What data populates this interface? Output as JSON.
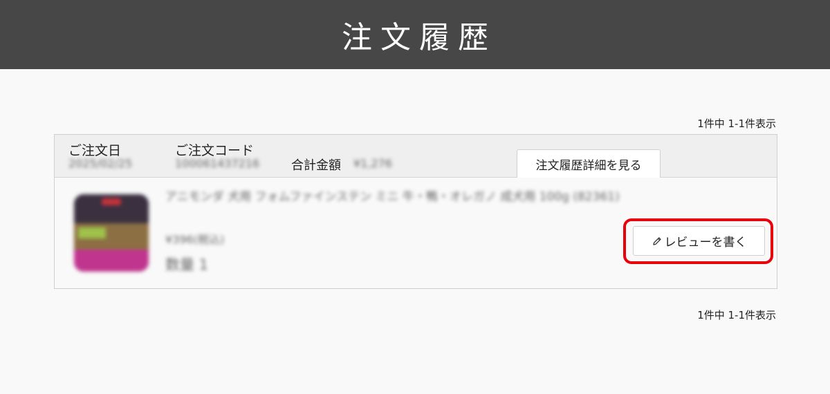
{
  "header": {
    "title": "注文履歴"
  },
  "pagination": {
    "top": "1件中 1-1件表示",
    "bottom": "1件中 1-1件表示"
  },
  "order": {
    "date_label": "ご注文日",
    "date_value": "2025/02/25",
    "code_label": "ご注文コード",
    "code_value": "100061437216",
    "total_label": "合計金額",
    "total_value": "¥1,276",
    "detail_button": "注文履歴詳細を見る",
    "item": {
      "name": "アニモンダ 犬用 フォムファインステン ミニ 牛・鴨・オレガノ 成犬用 100g (82361)",
      "price": "¥396(税込)",
      "quantity": "数量 1",
      "thumbnail_icon": "product-image"
    },
    "review_button": "レビューを書く",
    "review_icon": "pencil-icon"
  },
  "colors": {
    "header_bg": "#474747",
    "highlight": "#e8000b"
  }
}
